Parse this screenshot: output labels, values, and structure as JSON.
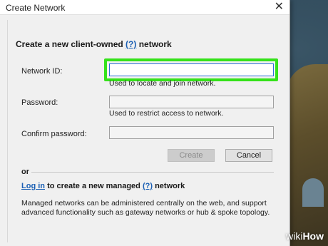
{
  "window": {
    "title": "Create Network",
    "close_glyph": "✕"
  },
  "heading": {
    "prefix": "Create a new client-owned",
    "help": "(?)",
    "suffix": "network"
  },
  "fields": {
    "network_id": {
      "label": "Network ID:",
      "value": "",
      "hint": "Used to locate and join network."
    },
    "password": {
      "label": "Password:",
      "value": "",
      "hint": "Used to restrict access to network."
    },
    "confirm": {
      "label": "Confirm password:",
      "value": ""
    }
  },
  "buttons": {
    "create": "Create",
    "cancel": "Cancel"
  },
  "or_text": "or",
  "managed": {
    "login": "Log in",
    "middle": "to create a new managed",
    "help": "(?)",
    "suffix": "network"
  },
  "description": "Managed networks can be administered centrally on the web, and support advanced functionality such as gateway networks or hub & spoke topology.",
  "watermark": {
    "wiki": "wiki",
    "how": "How"
  },
  "colors": {
    "highlight": "#35e21a",
    "link": "#1a5fb4"
  }
}
